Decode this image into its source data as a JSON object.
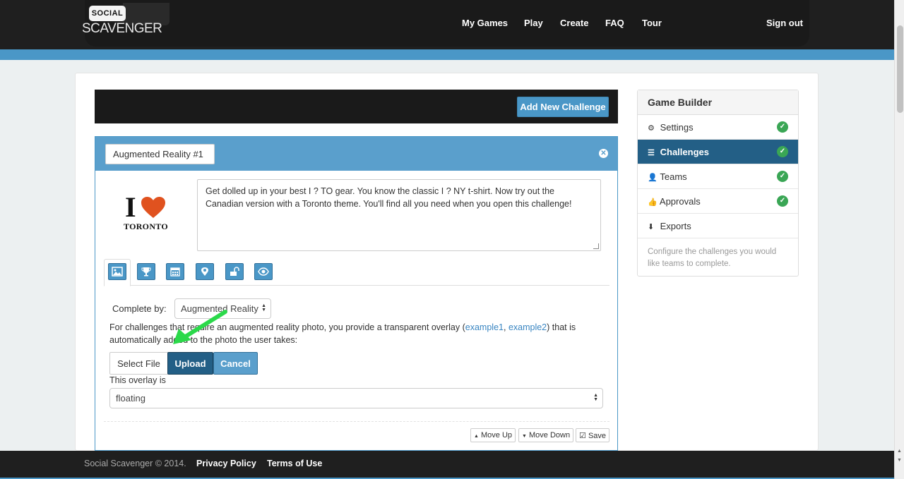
{
  "logo": {
    "badge": "SOCIAL",
    "name": "SCAVENGER"
  },
  "nav": {
    "my_games": "My Games",
    "play": "Play",
    "create": "Create",
    "faq": "FAQ",
    "tour": "Tour",
    "sign_out": "Sign out"
  },
  "toolbar": {
    "add_challenge": "Add New Challenge"
  },
  "challenge": {
    "title": "Augmented Reality #1",
    "image_alt": {
      "i": "I",
      "city": "TORONTO"
    },
    "description": "Get dolled up in your best I ?  TO gear. You know the classic I ?  NY t-shirt. Now try out the Canadian version with a Toronto theme. You'll find all you need when you open this challenge!",
    "complete_by_label": "Complete by:",
    "complete_by_value": "Augmented Reality",
    "help_prefix": "For challenges that require an augmented reality photo, you provide a transparent overlay (",
    "example1": "example1",
    "help_sep": ", ",
    "example2": "example2",
    "help_suffix": ") that is automatically added to the photo the user takes:",
    "select_file": "Select File",
    "upload": "Upload",
    "cancel": "Cancel",
    "overlay_label": "This overlay is",
    "overlay_value": "floating",
    "move_up": "Move Up",
    "move_down": "Move Down",
    "save": "Save"
  },
  "sidebar": {
    "title": "Game Builder",
    "items": [
      {
        "label": "Settings",
        "icon": "gear-icon",
        "done": true
      },
      {
        "label": "Challenges",
        "icon": "list-icon",
        "done": true,
        "active": true
      },
      {
        "label": "Teams",
        "icon": "user-icon",
        "done": true
      },
      {
        "label": "Approvals",
        "icon": "thumbs-up-icon",
        "done": true
      },
      {
        "label": "Exports",
        "icon": "download-icon",
        "done": false
      }
    ],
    "help": "Configure the challenges you would like teams to complete."
  },
  "footer": {
    "copyright": "Social Scavenger © 2014.",
    "privacy": "Privacy Policy",
    "terms": "Terms of Use"
  },
  "colors": {
    "brand_blue": "#4a97c7",
    "dark_blue": "#235f86",
    "success": "#3aa655",
    "annotation_arrow": "#2bd94a"
  }
}
